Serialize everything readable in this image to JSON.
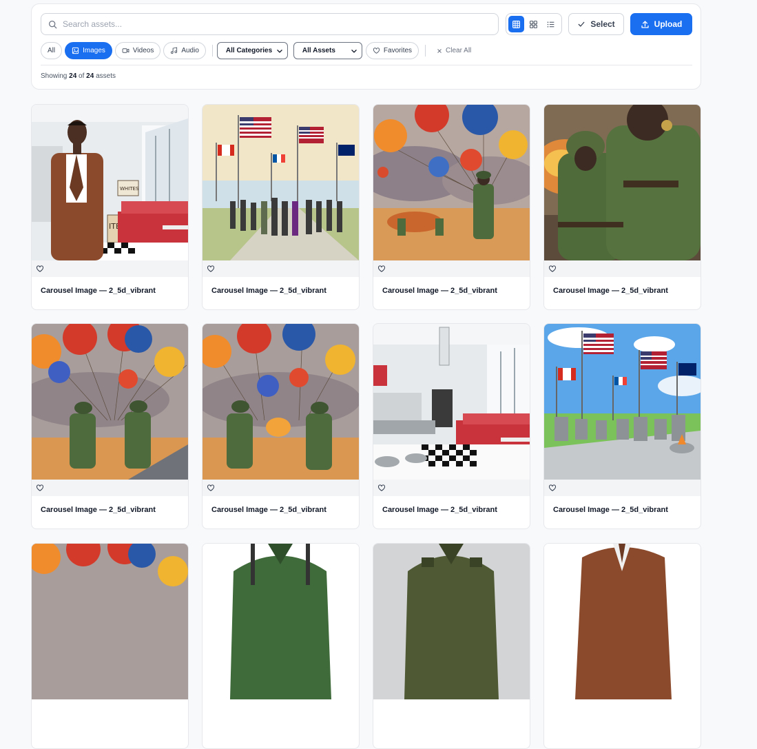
{
  "search": {
    "placeholder": "Search assets..."
  },
  "view_modes": [
    {
      "icon": "grid-large-icon",
      "active": true
    },
    {
      "icon": "grid-small-icon",
      "active": false
    },
    {
      "icon": "list-icon",
      "active": false
    }
  ],
  "actions": {
    "select_label": "Select",
    "upload_label": "Upload"
  },
  "filters": {
    "type_chips": [
      {
        "label": "All",
        "icon": "",
        "active": false
      },
      {
        "label": "Images",
        "icon": "image-icon",
        "active": true
      },
      {
        "label": "Videos",
        "icon": "video-icon",
        "active": false
      },
      {
        "label": "Audio",
        "icon": "music-icon",
        "active": false
      }
    ],
    "category_select": "All Categories",
    "asset_select": "All Assets",
    "favorites_label": "Favorites",
    "clear_label": "Clear All"
  },
  "status": {
    "prefix": "Showing",
    "shown": "24",
    "of": "of",
    "total": "24",
    "suffix": "assets"
  },
  "cards": [
    {
      "title": "Carousel Image — 2_5d_vibrant",
      "thumb": "diner-man"
    },
    {
      "title": "Carousel Image — 2_5d_vibrant",
      "thumb": "memorial-crowd"
    },
    {
      "title": "Carousel Image — 2_5d_vibrant",
      "thumb": "balloons-soldier"
    },
    {
      "title": "Carousel Image — 2_5d_vibrant",
      "thumb": "soldiers-battle"
    },
    {
      "title": "Carousel Image — 2_5d_vibrant",
      "thumb": "balloons-two"
    },
    {
      "title": "Carousel Image — 2_5d_vibrant",
      "thumb": "balloons-two"
    },
    {
      "title": "Carousel Image — 2_5d_vibrant",
      "thumb": "diner-empty"
    },
    {
      "title": "Carousel Image — 2_5d_vibrant",
      "thumb": "memorial-flags"
    },
    {
      "title": "",
      "thumb": "balloons-partial"
    },
    {
      "title": "",
      "thumb": "uniform-green"
    },
    {
      "title": "",
      "thumb": "uniform-gray"
    },
    {
      "title": "",
      "thumb": "suit-brown"
    }
  ],
  "colors": {
    "accent": "#1a6ef0",
    "border": "#e5e7eb",
    "muted": "#6b7280"
  }
}
